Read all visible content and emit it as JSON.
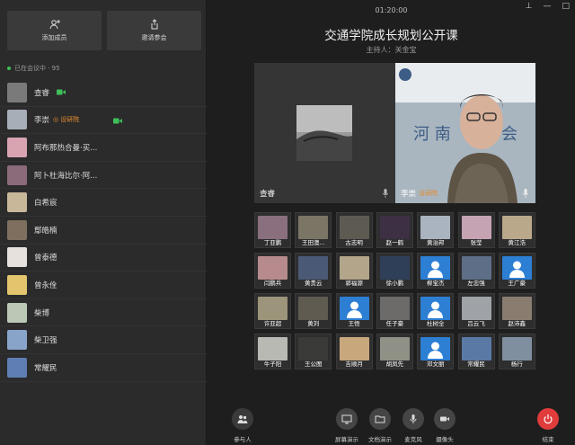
{
  "sidebar": {
    "add_member": "添加成员",
    "invite": "邀请参会",
    "in_meeting": "已在会议中 · 95",
    "members": [
      {
        "name": "查睿",
        "role": "",
        "cam": true,
        "color": "#7a7a7a"
      },
      {
        "name": "李崇",
        "role": "设研院",
        "cam": true,
        "color": "#a7aeb8"
      },
      {
        "name": "阿布那热合曼·买...",
        "role": "",
        "cam": false,
        "color": "#d9a4b1"
      },
      {
        "name": "阿卜杜海比尔·阿...",
        "role": "",
        "cam": false,
        "color": "#8b6a7a"
      },
      {
        "name": "白希宸",
        "role": "",
        "cam": false,
        "color": "#c9b79a"
      },
      {
        "name": "鄢皓楠",
        "role": "",
        "cam": false,
        "color": "#7e6f5f"
      },
      {
        "name": "曾泰德",
        "role": "",
        "cam": false,
        "color": "#e6e1dc"
      },
      {
        "name": "曾永佺",
        "role": "",
        "cam": false,
        "color": "#e2c56c"
      },
      {
        "name": "柴博",
        "role": "",
        "cam": false,
        "color": "#bcc8b6"
      },
      {
        "name": "柴卫强",
        "role": "",
        "cam": false,
        "color": "#89a4c9"
      },
      {
        "name": "常耀民",
        "role": "",
        "cam": false,
        "color": "#5f7fb3"
      }
    ]
  },
  "header": {
    "time": "01:20:00",
    "title": "交通学院成长规划公开课",
    "host": "主持人：关金宝"
  },
  "videos": [
    {
      "name": "查睿",
      "role": ""
    },
    {
      "name": "李崇",
      "role": "设研院"
    }
  ],
  "grid": [
    [
      "丁亚鹏",
      "王田澳...",
      "古志明",
      "赵一鹤",
      "黄治邦",
      "张莹",
      "黄江浩"
    ],
    [
      "闫鹏兵",
      "黄贵云",
      "郭福源",
      "徐小鹏",
      "柳宝杰",
      "左忠强",
      "王广豪"
    ],
    [
      "许亚超",
      "黄刘",
      "王悟",
      "任子豪",
      "杜树全",
      "吕云飞",
      "赵沛鑫"
    ],
    [
      "牛子阳",
      "王公图",
      "吉顺月",
      "胡凤先",
      "邓文丽",
      "常耀民",
      "杨行"
    ]
  ],
  "grid_colors": [
    [
      "#8a6f7e",
      "#7b7566",
      "#5d5a52",
      "#3d2f44",
      "#a9b4c0",
      "#c5a3b2",
      "#b9a98a"
    ],
    [
      "#b78b8e",
      "#4a5a76",
      "#b3a58a",
      "#2f3f58",
      "#2d7fd4",
      "#5e6e86",
      "#2d7fd4"
    ],
    [
      "#9c947b",
      "#5f5b51",
      "#2d7fd4",
      "#6c6b6a",
      "#2d7fd4",
      "#9fa2a6",
      "#8a7d70"
    ],
    [
      "#b9b9b3",
      "#3a3a38",
      "#c9a77d",
      "#8f9186",
      "#2d7fd4",
      "#5a7aa5",
      "#7f8f9f"
    ]
  ],
  "controls": {
    "participants": "参与人",
    "screen_share": "屏幕演示",
    "doc_share": "文档演示",
    "mic": "麦克风",
    "camera": "摄像头",
    "end": "结束"
  }
}
